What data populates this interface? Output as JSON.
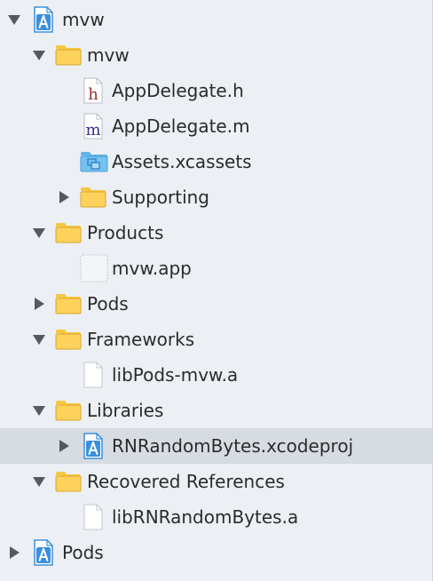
{
  "navigator": {
    "items": [
      {
        "label": "mvw",
        "depth": 0,
        "disclosure": "open",
        "icon": "xcode-project-icon",
        "name": "project-mvw"
      },
      {
        "label": "mvw",
        "depth": 1,
        "disclosure": "open",
        "icon": "folder-icon",
        "name": "group-mvw"
      },
      {
        "label": "AppDelegate.h",
        "depth": 2,
        "disclosure": "none",
        "icon": "header-file-icon",
        "name": "file-appdelegate-h"
      },
      {
        "label": "AppDelegate.m",
        "depth": 2,
        "disclosure": "none",
        "icon": "objc-source-file-icon",
        "name": "file-appdelegate-m"
      },
      {
        "label": "Assets.xcassets",
        "depth": 2,
        "disclosure": "none",
        "icon": "asset-catalog-folder-icon",
        "name": "file-assets-xcassets"
      },
      {
        "label": "Supporting",
        "depth": 2,
        "disclosure": "closed",
        "icon": "folder-icon",
        "name": "group-supporting"
      },
      {
        "label": "Products",
        "depth": 1,
        "disclosure": "open",
        "icon": "folder-icon",
        "name": "group-products"
      },
      {
        "label": "mvw.app",
        "depth": 2,
        "disclosure": "none",
        "icon": "app-product-icon",
        "name": "file-mvw-app"
      },
      {
        "label": "Pods",
        "depth": 1,
        "disclosure": "closed",
        "icon": "folder-icon",
        "name": "group-pods"
      },
      {
        "label": "Frameworks",
        "depth": 1,
        "disclosure": "open",
        "icon": "folder-icon",
        "name": "group-frameworks"
      },
      {
        "label": "libPods-mvw.a",
        "depth": 2,
        "disclosure": "none",
        "icon": "document-icon",
        "name": "file-libpods-mvw-a"
      },
      {
        "label": "Libraries",
        "depth": 1,
        "disclosure": "open",
        "icon": "folder-icon",
        "name": "group-libraries"
      },
      {
        "label": "RNRandomBytes.xcodeproj",
        "depth": 2,
        "disclosure": "closed",
        "icon": "xcode-project-icon",
        "name": "project-rnrandombytes",
        "selected": true
      },
      {
        "label": "Recovered References",
        "depth": 1,
        "disclosure": "open",
        "icon": "folder-icon",
        "name": "group-recovered-references"
      },
      {
        "label": "libRNRandomBytes.a",
        "depth": 2,
        "disclosure": "none",
        "icon": "document-icon",
        "name": "file-librnrandombytes-a"
      },
      {
        "label": "Pods",
        "depth": 0,
        "disclosure": "closed",
        "icon": "xcode-project-icon",
        "name": "project-pods"
      }
    ]
  },
  "colors": {
    "background": "#eceff3",
    "selection": "#d7dce2",
    "text": "#2b2b2b",
    "disclosure": "#555a61",
    "folder": "#fcd15c",
    "folder_tab": "#f7c742",
    "folder_stroke": "#d9a82a",
    "project_blue": "#3b8fdc",
    "asset_folder": "#74c2f1",
    "header_h": "#9b2d2d",
    "source_m": "#3b2f8a"
  }
}
